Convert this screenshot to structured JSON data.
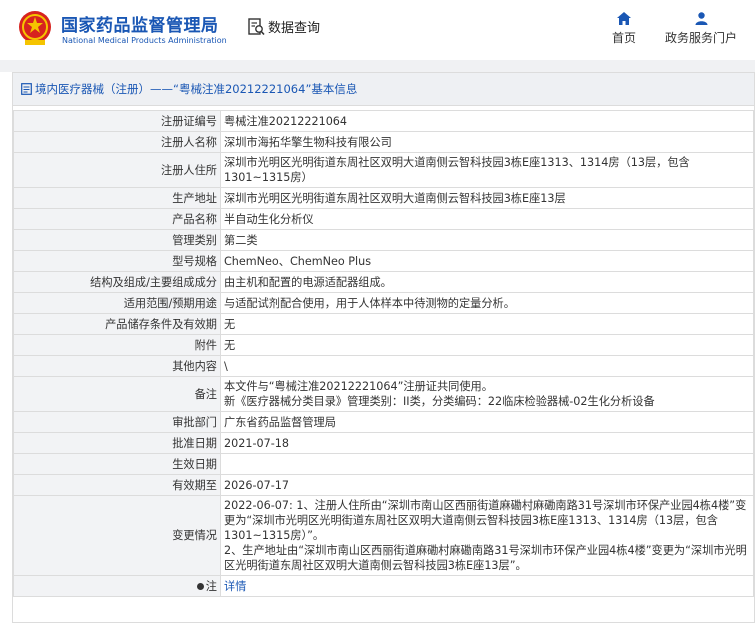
{
  "header": {
    "logo_cn": "国家药品监督管理局",
    "logo_en": "National Medical Products Administration",
    "query_label": "数据查询",
    "nav": [
      {
        "label": "首页",
        "icon": "home-icon"
      },
      {
        "label": "政务服务门户",
        "icon": "user-icon"
      }
    ]
  },
  "panel": {
    "title": "境内医疗器械（注册）——“粤械注准20212221064”基本信息"
  },
  "rows": [
    {
      "key": "注册证编号",
      "value": "粤械注准20212221064"
    },
    {
      "key": "注册人名称",
      "value": "深圳市海拓华擎生物科技有限公司"
    },
    {
      "key": "注册人住所",
      "value": "深圳市光明区光明街道东周社区双明大道南侧云智科技园3栋E座1313、1314房（13层，包含1301~1315房）"
    },
    {
      "key": "生产地址",
      "value": "深圳市光明区光明街道东周社区双明大道南侧云智科技园3栋E座13层"
    },
    {
      "key": "产品名称",
      "value": "半自动生化分析仪"
    },
    {
      "key": "管理类别",
      "value": "第二类"
    },
    {
      "key": "型号规格",
      "value": "ChemNeo、ChemNeo Plus"
    },
    {
      "key": "结构及组成/主要组成成分",
      "value": "由主机和配置的电源适配器组成。"
    },
    {
      "key": "适用范围/预期用途",
      "value": "与适配试剂配合使用，用于人体样本中待测物的定量分析。"
    },
    {
      "key": "产品储存条件及有效期",
      "value": "无"
    },
    {
      "key": "附件",
      "value": "无"
    },
    {
      "key": "其他内容",
      "value": "\\"
    },
    {
      "key": "备注",
      "value_lines": [
        "本文件与“粤械注准20212221064”注册证共同使用。",
        "新《医疗器械分类目录》管理类别：II类，分类编码：22临床检验器械-02生化分析设备"
      ]
    },
    {
      "key": "审批部门",
      "value": "广东省药品监督管理局"
    },
    {
      "key": "批准日期",
      "value": "2021-07-18"
    },
    {
      "key": "生效日期",
      "value": ""
    },
    {
      "key": "有效期至",
      "value": "2026-07-17"
    },
    {
      "key": "变更情况",
      "value_lines": [
        "2022-06-07: 1、注册人住所由“深圳市南山区西丽街道麻磡村麻磡南路31号深圳市环保产业园4栋4楼”变更为“深圳市光明区光明街道东周社区双明大道南侧云智科技园3栋E座1313、1314房（13层，包含1301~1315房）”。",
        "2、生产地址由“深圳市南山区西丽街道麻磡村麻磡南路31号深圳市环保产业园4栋4楼”变更为“深圳市光明区光明街道东周社区双明大道南侧云智科技园3栋E座13层”。"
      ]
    },
    {
      "key": "注",
      "icon": "pin-icon",
      "value": "详情"
    }
  ]
}
